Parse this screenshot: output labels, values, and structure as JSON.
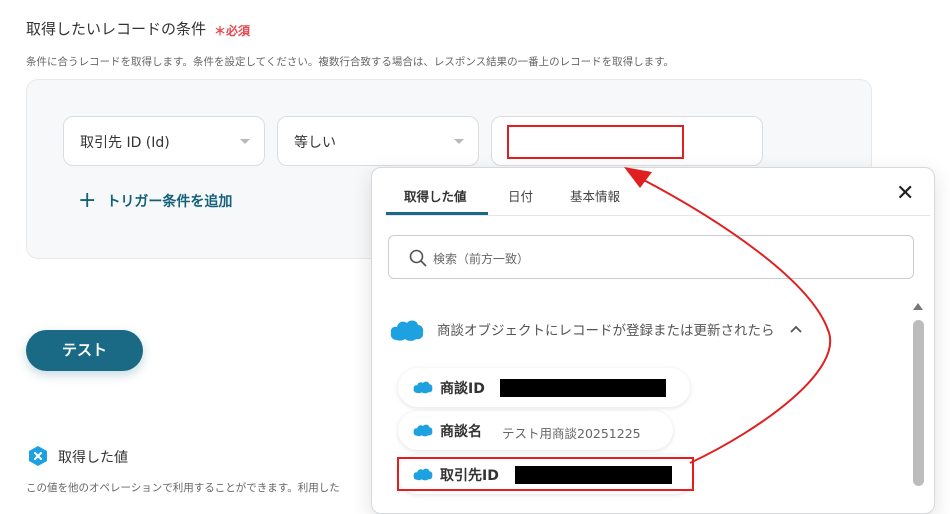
{
  "section": {
    "title": "取得したいレコードの条件",
    "required_mark": "＊必須",
    "description": "条件に合うレコードを取得します。条件を設定してください。複数行合致する場合は、レスポンス結果の一番上のレコードを取得します。"
  },
  "condition": {
    "field_value": "取引先 ID (Id)",
    "operator_value": "等しい",
    "compare_value": ""
  },
  "add_trigger_label": "トリガー条件を追加",
  "test_button_label": "テスト",
  "retrieved_values": {
    "title": "取得した値",
    "description": "この値を他のオペレーションで利用することができます。利用した"
  },
  "popup": {
    "tabs": [
      "取得した値",
      "日付",
      "基本情報"
    ],
    "active_tab": "取得した値",
    "search_placeholder": "検索（前方一致）",
    "group_label": "商談オブジェクトにレコードが登録または更新されたら",
    "items": [
      {
        "label": "商談ID",
        "sample": ""
      },
      {
        "label": "商談名",
        "sample": "テスト用商談20251225"
      },
      {
        "label": "取引先ID",
        "sample": ""
      }
    ]
  },
  "colors": {
    "accent": "#1b6a85",
    "required": "#e5484d",
    "highlight": "#e02020",
    "salesforce": "#1ea1e0"
  }
}
